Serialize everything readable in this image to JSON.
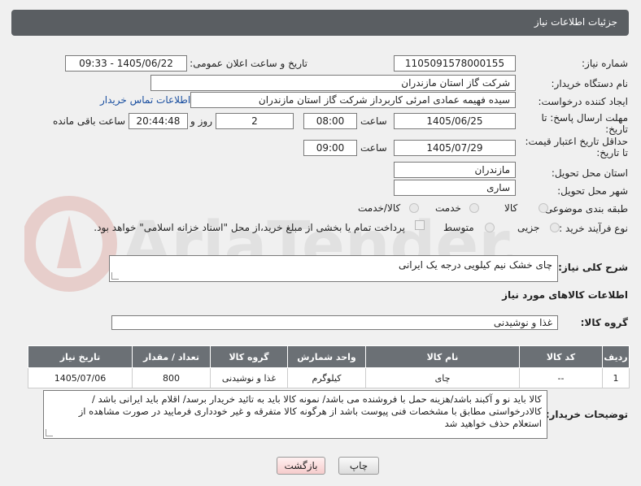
{
  "header": {
    "title": "جزئیات اطلاعات نیاز"
  },
  "fields": {
    "need_number_label": "شماره نیاز:",
    "need_number": "1105091578000155",
    "announce_label": "تاریخ و ساعت اعلان عمومی:",
    "announce_value": "1405/06/22 - 09:33",
    "buyer_org_label": "نام دستگاه خریدار:",
    "buyer_org": "شرکت گاز استان مازندران",
    "creator_label": "ایجاد کننده درخواست:",
    "creator": "سیده فهیمه عمادی امرئی کاربرداز شرکت گاز استان مازندران",
    "contact_link": "اطلاعات تماس خریدار",
    "deadline_label_1": "مهلت ارسال پاسخ: تا",
    "deadline_label_2": "تاریخ:",
    "deadline_date": "1405/06/25",
    "time_word": "ساعت",
    "deadline_time": "08:00",
    "days_value": "2",
    "days_word": "روز و",
    "remaining_value": "20:44:48",
    "remaining_word": "ساعت باقی مانده",
    "validity_label_1": "حداقل تاریخ اعتبار قیمت:",
    "validity_label_2": "تا تاریخ:",
    "validity_date": "1405/07/29",
    "validity_time": "09:00",
    "province_label": "استان محل تحویل:",
    "province": "مازندران",
    "city_label": "شهر محل تحویل:",
    "city": "ساری",
    "category_label": "طبقه بندی موضوعی:",
    "category_options": [
      "کالا",
      "خدمت",
      "کالا/خدمت"
    ],
    "process_label": "نوع فرآیند خرید :",
    "process_options": [
      "جزیی",
      "متوسط"
    ],
    "payment_note": "پرداخت تمام یا بخشی از مبلغ خرید،از محل \"اسناد خزانه اسلامی\" خواهد بود.",
    "desc_label": "شرح کلی نیاز:",
    "desc_value": "چای خشک نیم کیلویی درجه یک ایرانی",
    "goods_info_title": "اطلاعات کالاهای مورد نیاز",
    "goods_group_label": "گروه کالا:",
    "goods_group": "غذا و نوشیدنی"
  },
  "table": {
    "headers": [
      "ردیف",
      "کد کالا",
      "نام کالا",
      "واحد شمارش",
      "گروه کالا",
      "تعداد / مقدار",
      "تاریخ نیاز"
    ],
    "rows": [
      [
        "1",
        "--",
        "چای",
        "کیلوگرم",
        "غذا و نوشیدنی",
        "800",
        "1405/07/06"
      ]
    ]
  },
  "notes": {
    "label": "توضیحات خریدار:",
    "text": "کالا باید نو و آکبند باشد/هزینه حمل با فروشنده می باشد/ نمونه کالا باید به تائید خریدار برسد/ اقلام باید ایرانی باشد / کالادرخواستی مطابق با مشخصات فنی پیوست باشد از هرگونه کالا متفرقه و غیر خودداری فرمایید در صورت مشاهده از استعلام حذف خواهید شد"
  },
  "buttons": {
    "print": "چاپ",
    "back": "بازگشت"
  },
  "watermark_text": "AriaTender.net",
  "colors": {
    "header_bg": "#5a5e62",
    "link": "#1a4fa0",
    "back_button": "#f6cccc"
  }
}
